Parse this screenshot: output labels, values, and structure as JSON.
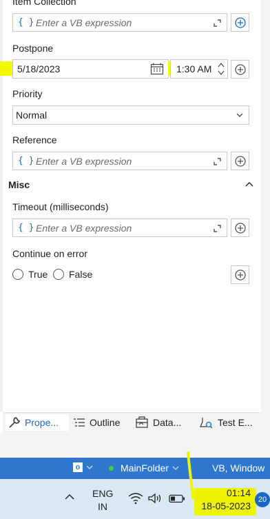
{
  "properties": {
    "item_collection": {
      "label": "Item Collection",
      "placeholder": "Enter a VB expression",
      "brace": "{ }"
    },
    "postpone": {
      "label": "Postpone",
      "date": "5/18/2023",
      "time": "1:30 AM"
    },
    "priority": {
      "label": "Priority",
      "value": "Normal"
    },
    "reference": {
      "label": "Reference",
      "placeholder": "Enter a VB expression",
      "brace": "{ }"
    },
    "misc": {
      "title": "Misc"
    },
    "timeout": {
      "label": "Timeout (milliseconds)",
      "placeholder": "Enter a VB expression",
      "brace": "{ }"
    },
    "continue_on_error": {
      "label": "Continue on error",
      "option_true": "True",
      "option_false": "False"
    }
  },
  "tabs": [
    {
      "label": "Prope...",
      "icon": "wrench-icon",
      "active": true
    },
    {
      "label": "Outline",
      "icon": "outline-icon"
    },
    {
      "label": "Data...",
      "icon": "data-icon"
    },
    {
      "label": "Test E...",
      "icon": "test-explorer-icon"
    }
  ],
  "statusbar": {
    "o_badge": "o",
    "folder": "MainFolder",
    "lang": "VB, Window"
  },
  "taskbar": {
    "input_lang": "ENG",
    "input_region": "IN",
    "time": "01:14",
    "date": "18-05-2023",
    "notification_count": "20"
  },
  "colors": {
    "accent": "#1769c3",
    "highlight": "#f3f900",
    "statusbar": "#2f77cc",
    "taskbar": "#dbe7f3",
    "online_dot": "#3fd13f"
  }
}
